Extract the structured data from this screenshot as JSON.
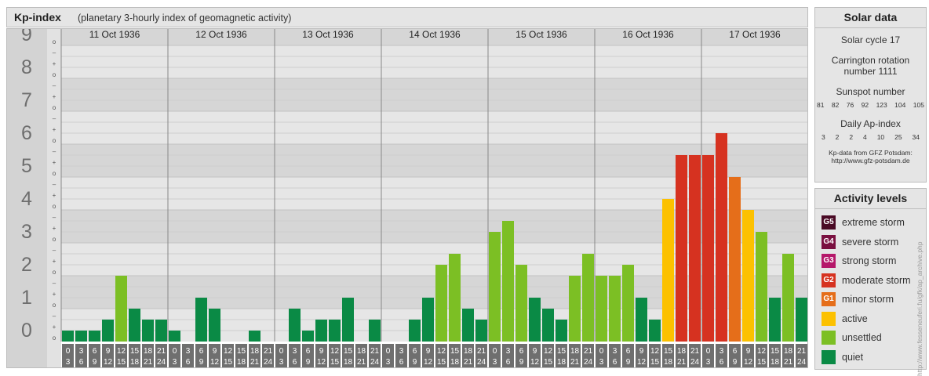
{
  "header": {
    "title": "Kp-index",
    "subtitle": "(planetary 3-hourly index of geomagnetic activity)"
  },
  "chart_data": {
    "type": "bar",
    "ylim": [
      0,
      9
    ],
    "y_ticks": [
      "0",
      "1",
      "2",
      "3",
      "4",
      "5",
      "6",
      "7",
      "8",
      "9"
    ],
    "minor_ticks": [
      "o",
      "+",
      "–"
    ],
    "days": [
      "11 Oct 1936",
      "12 Oct 1936",
      "13 Oct 1936",
      "14 Oct 1936",
      "15 Oct 1936",
      "16 Oct 1936",
      "17 Oct 1936"
    ],
    "intervals_top": [
      "0",
      "3",
      "6",
      "9",
      "12",
      "15",
      "18",
      "21"
    ],
    "intervals_bottom": [
      "3",
      "6",
      "9",
      "12",
      "15",
      "18",
      "21",
      "24"
    ],
    "values": [
      [
        0.333,
        0.333,
        0.333,
        0.667,
        2.0,
        1.0,
        0.667,
        0.667
      ],
      [
        0.333,
        0.0,
        1.333,
        1.0,
        0.0,
        0.0,
        0.333,
        0.0
      ],
      [
        0.0,
        1.0,
        0.333,
        0.667,
        0.667,
        1.333,
        0.0,
        0.667
      ],
      [
        0.0,
        0.0,
        0.667,
        1.333,
        2.333,
        2.667,
        1.0,
        0.667
      ],
      [
        3.333,
        3.667,
        2.333,
        1.333,
        1.0,
        0.667,
        2.0,
        2.667
      ],
      [
        2.0,
        2.0,
        2.333,
        1.333,
        0.667,
        4.333,
        5.667,
        5.667
      ],
      [
        5.667,
        6.333,
        5.0,
        4.0,
        3.333,
        1.333,
        2.667,
        1.333
      ]
    ],
    "colors": {
      "quiet": "#0a8a45",
      "unsettled": "#7cbf24",
      "active": "#fcc100",
      "minor": "#e56e1a",
      "moderate": "#d63220"
    }
  },
  "solar": {
    "title": "Solar data",
    "cycle": "Solar cycle 17",
    "carrington_1": "Carrington rotation",
    "carrington_2": "number 1111",
    "sunspot_label": "Sunspot number",
    "sunspot_numbers": [
      "81",
      "82",
      "76",
      "92",
      "123",
      "104",
      "105"
    ],
    "ap_label": "Daily Ap-index",
    "ap_values": [
      "3",
      "2",
      "2",
      "4",
      "10",
      "25",
      "34"
    ],
    "source_1": "Kp-data from GFZ Potsdam:",
    "source_2": "http://www.gfz-potsdam.de"
  },
  "levels": {
    "title": "Activity levels",
    "items": [
      {
        "code": "G5",
        "label": "extreme storm",
        "color": "#4a0a25"
      },
      {
        "code": "G4",
        "label": "severe storm",
        "color": "#7a1040"
      },
      {
        "code": "G3",
        "label": "strong storm",
        "color": "#b5186a"
      },
      {
        "code": "G2",
        "label": "moderate storm",
        "color": "#d63220"
      },
      {
        "code": "G1",
        "label": "minor storm",
        "color": "#e56e1a"
      },
      {
        "code": "",
        "label": "active",
        "color": "#fcc100"
      },
      {
        "code": "",
        "label": "unsettled",
        "color": "#7cbf24"
      },
      {
        "code": "",
        "label": "quiet",
        "color": "#0a8a45"
      }
    ]
  },
  "credit": "http://www.fesseneuferi.fu/gfk/ap_archive.php"
}
